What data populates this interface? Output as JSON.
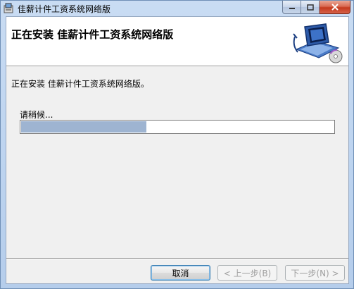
{
  "window": {
    "title": "佳薪计件工资系统网络版"
  },
  "banner": {
    "title": "正在安装  佳薪计件工资系统网络版"
  },
  "status": {
    "message": "正在安装  佳薪计件工资系统网络版。"
  },
  "progress": {
    "label": "请稍候...",
    "percent": 40
  },
  "buttons": {
    "cancel": "取消",
    "back": "< 上一步(B)",
    "next": "下一步(N) >"
  },
  "colors": {
    "progress_fill": "#9eb4d1",
    "titlebar": "#bcd3ef",
    "close_button": "#c4391d"
  },
  "icons": {
    "app": "installer-icon",
    "banner": "computer-cd-icon"
  }
}
